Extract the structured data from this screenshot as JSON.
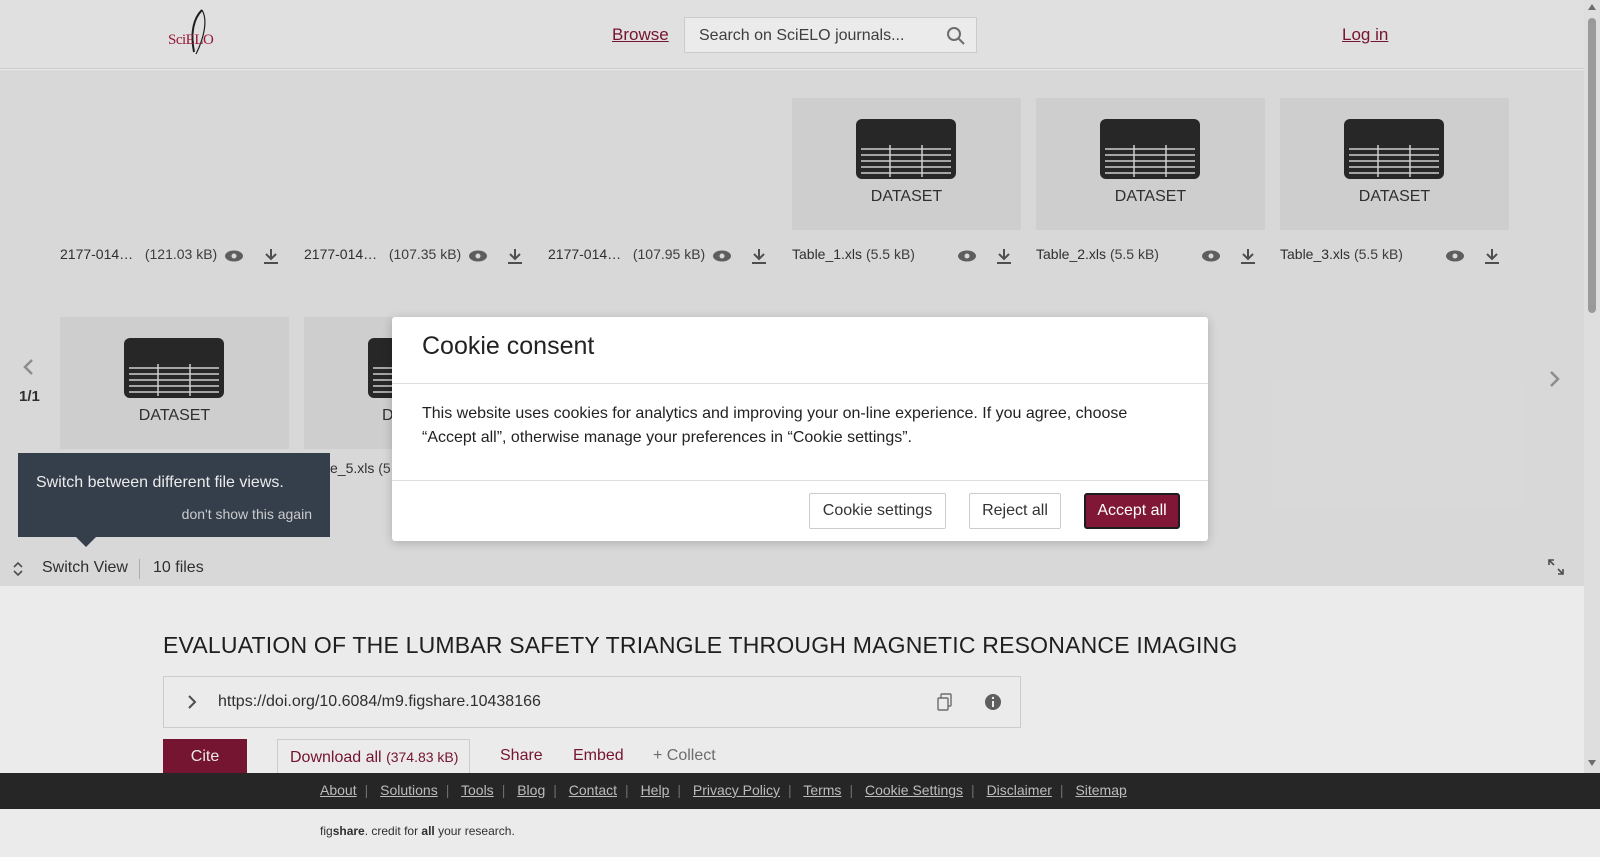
{
  "header": {
    "logo_text": "SciELO",
    "browse": "Browse",
    "search_placeholder": "Search on SciELO journals...",
    "login": "Log in"
  },
  "viewer": {
    "card_label": "DATASET",
    "row1_files": [
      {
        "name": "2177-014…",
        "size": "(121.03 kB)"
      },
      {
        "name": "2177-014…",
        "size": "(107.35 kB)"
      },
      {
        "name": "2177-014…",
        "size": "(107.95 kB)"
      },
      {
        "name": "Table_1.xls",
        "size": "(5.5 kB)"
      },
      {
        "name": "Table_2.xls",
        "size": "(5.5 kB)"
      },
      {
        "name": "Table_3.xls",
        "size": "(5.5 kB)"
      }
    ],
    "row2_partial_file": "e_5.xls",
    "row2_partial_size": "(5",
    "row2_partial_label": "D",
    "pager": "1/1",
    "tooltip_text": "Switch between different file views.",
    "tooltip_dismiss": "don't show this again",
    "switch_view": "Switch View",
    "files_count": "10 files"
  },
  "article": {
    "title": "EVALUATION OF THE LUMBAR SAFETY TRIANGLE THROUGH MAGNETIC RESONANCE IMAGING",
    "doi": "https://doi.org/10.6084/m9.figshare.10438166",
    "cite": "Cite",
    "download_all": "Download all",
    "download_size": "(374.83 kB)",
    "share": "Share",
    "embed": "Embed",
    "collect": "+ Collect"
  },
  "footer": {
    "links": [
      "About",
      "Solutions",
      "Tools",
      "Blog",
      "Contact",
      "Help",
      "Privacy Policy",
      "Terms",
      "Cookie Settings",
      "Disclaimer",
      "Sitemap"
    ],
    "tagline_prefix": "fig",
    "tagline_brand": "share",
    "tagline_mid": ". credit for ",
    "tagline_all": "all",
    "tagline_suffix": " your research."
  },
  "cookie_modal": {
    "title": "Cookie consent",
    "body": "This website uses cookies for analytics and improving your on-line experience. If you agree, choose “Accept all”, otherwise manage your preferences in “Cookie settings”.",
    "settings_button": "Cookie settings",
    "reject_button": "Reject all",
    "accept_button": "Accept all"
  },
  "colors": {
    "brand": "#801736",
    "footer_bg": "#2a2a2a",
    "tooltip_bg": "#3a4553"
  }
}
